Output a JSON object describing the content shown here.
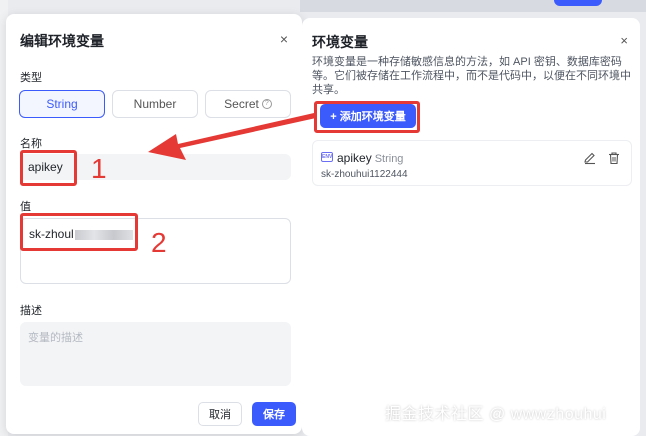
{
  "modal": {
    "title": "编辑环境变量",
    "close": "×",
    "type_label": "类型",
    "types": [
      "String",
      "Number",
      "Secret"
    ],
    "name_label": "名称",
    "name_value": "apikey",
    "value_label": "值",
    "value_text": "sk-zhoul",
    "desc_label": "描述",
    "desc_placeholder": "变量的描述",
    "cancel_label": "取消",
    "save_label": "保存"
  },
  "panel": {
    "title": "环境变量",
    "close": "×",
    "description": "环境变量是一种存储敏感信息的方法，如 API 密钥、数据库密码等。它们被存储在工作流程中，而不是代码中，以便在不同环境中共享。",
    "add_button": "+ 添加环境变量",
    "variable": {
      "icon_text": "ENV",
      "name": "apikey",
      "type": "String",
      "value": "sk-zhouhui1122444"
    }
  },
  "annotations": [
    "1",
    "2"
  ],
  "watermark": "掘金技术社区 @ wwwzhouhui",
  "colors": {
    "accent": "#3b5bfd",
    "annotation": "#e53935"
  }
}
